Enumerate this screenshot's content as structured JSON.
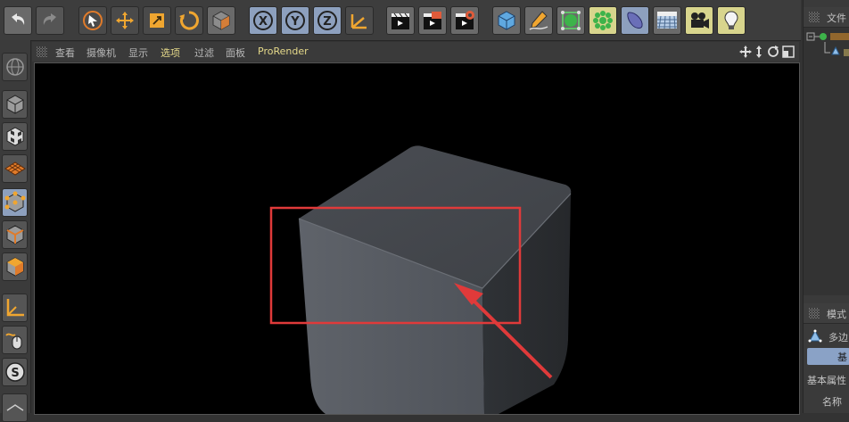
{
  "viewport_menu": {
    "items": [
      "查看",
      "摄像机",
      "显示",
      "选项",
      "过滤",
      "面板",
      "ProRender"
    ],
    "selected_index": 3
  },
  "right_panel": {
    "objects_tab": "文件",
    "attributes_tab": "模式",
    "polygon_label": "多边",
    "basic_tab": "基",
    "basic_properties": "基本属性",
    "name_label": "名称"
  },
  "toolbar_icons": [
    "undo-icon",
    "redo-icon",
    "select-icon",
    "move-icon",
    "scale-icon",
    "rotate-icon",
    "object-icon",
    "x-axis-icon",
    "y-axis-icon",
    "z-axis-icon",
    "coordinate-system-icon",
    "render-view-icon",
    "render-picture-viewer-icon",
    "render-settings-icon",
    "cube-icon",
    "pen-icon",
    "subdivision-icon",
    "array-icon",
    "deformer-icon",
    "floor-icon",
    "camera-icon",
    "light-icon"
  ],
  "colors": {
    "highlight_rect": "#e03a3a",
    "arrow": "#e03a3a",
    "active_menu": "#e5d98a",
    "active_tool": "#8da0be"
  }
}
